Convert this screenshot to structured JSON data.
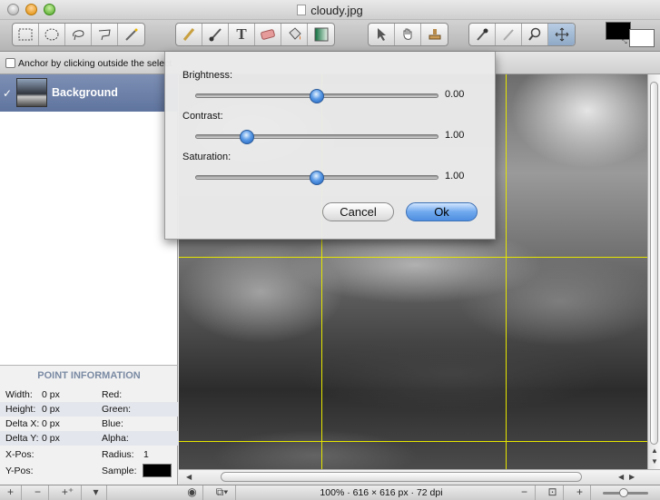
{
  "window": {
    "title": "cloudy.jpg"
  },
  "toolbar": {
    "groups": [
      [
        "rect-select-icon",
        "ellipse-select-icon",
        "lasso-icon",
        "poly-lasso-icon",
        "magic-wand-icon"
      ],
      [
        "pencil-icon",
        "brush-icon",
        "text-icon",
        "eraser-icon",
        "paint-bucket-icon",
        "gradient-icon"
      ],
      [
        "pointer-icon",
        "hand-icon",
        "stamp-icon"
      ],
      [
        "eyedropper-icon",
        "smudge-icon",
        "magnifier-icon",
        "move-icon"
      ]
    ],
    "text_glyph": "T",
    "colors": {
      "foreground": "#000000",
      "background": "#ffffff"
    }
  },
  "options": {
    "anchor_label": "Anchor by clicking outside the select"
  },
  "layers": [
    {
      "name": "Background",
      "visible": true
    }
  ],
  "point_info": {
    "title": "POINT INFORMATION",
    "rows": [
      {
        "l1": "Width:",
        "v1": "0 px",
        "l2": "Red:",
        "v2": ""
      },
      {
        "l1": "Height:",
        "v1": "0 px",
        "l2": "Green:",
        "v2": ""
      },
      {
        "l1": "Delta X:",
        "v1": "0 px",
        "l2": "Blue:",
        "v2": ""
      },
      {
        "l1": "Delta Y:",
        "v1": "0 px",
        "l2": "Alpha:",
        "v2": ""
      },
      {
        "l1": "X-Pos:",
        "v1": "",
        "l2": "Radius:",
        "v2": "1"
      },
      {
        "l1": "Y-Pos:",
        "v1": "",
        "l2": "Sample:",
        "v2": ""
      }
    ],
    "sample_color": "#000000"
  },
  "status": {
    "zoom_text": "100% · 616 × 616 px · 72 dpi"
  },
  "dialog": {
    "sliders": [
      {
        "label": "Brightness:",
        "value": "0.00",
        "fraction": 0.5
      },
      {
        "label": "Contrast:",
        "value": "1.00",
        "fraction": 0.21
      },
      {
        "label": "Saturation:",
        "value": "1.00",
        "fraction": 0.5
      }
    ],
    "cancel_label": "Cancel",
    "ok_label": "Ok"
  }
}
